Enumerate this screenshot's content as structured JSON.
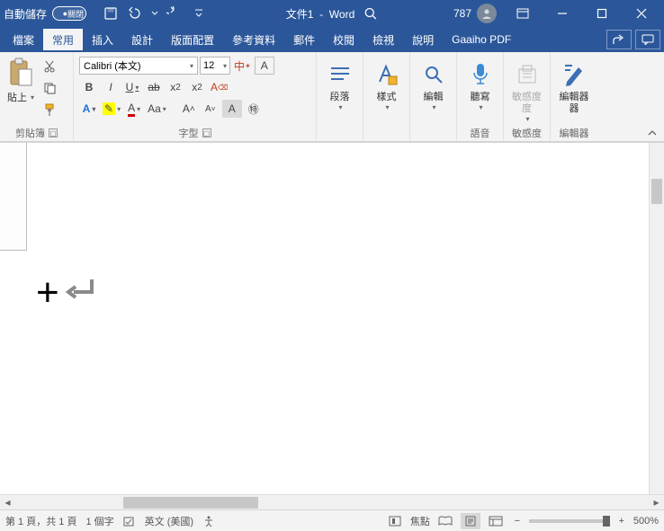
{
  "title": {
    "autosave_label": "自動儲存",
    "autosave_state": "關閉",
    "doc_name": "文件1",
    "app_name": "Word",
    "user_name": "787"
  },
  "tabs": {
    "file": "檔案",
    "home": "常用",
    "insert": "插入",
    "design": "設計",
    "layout": "版面配置",
    "references": "參考資料",
    "mailings": "郵件",
    "review": "校閱",
    "view": "檢視",
    "help": "說明",
    "gaaiho": "Gaaiho PDF"
  },
  "ribbon": {
    "paste": "貼上",
    "clipboard": "剪貼簿",
    "font": {
      "name": "Calibri (本文)",
      "size": "12",
      "phonetic": "中",
      "group": "字型"
    },
    "paragraph": "段落",
    "styles": "樣式",
    "editing": "編輯",
    "dictate": "聽寫",
    "voice": "語音",
    "sensitivity": "敏感度",
    "sensitivity_grp": "敏感度",
    "editor": "編輯器",
    "editor_grp": "編輯器"
  },
  "status": {
    "page": "第 1 頁，共 1 頁",
    "words": "1 個字",
    "lang": "英文 (美國)",
    "focus": "焦點",
    "zoom": "500%"
  }
}
